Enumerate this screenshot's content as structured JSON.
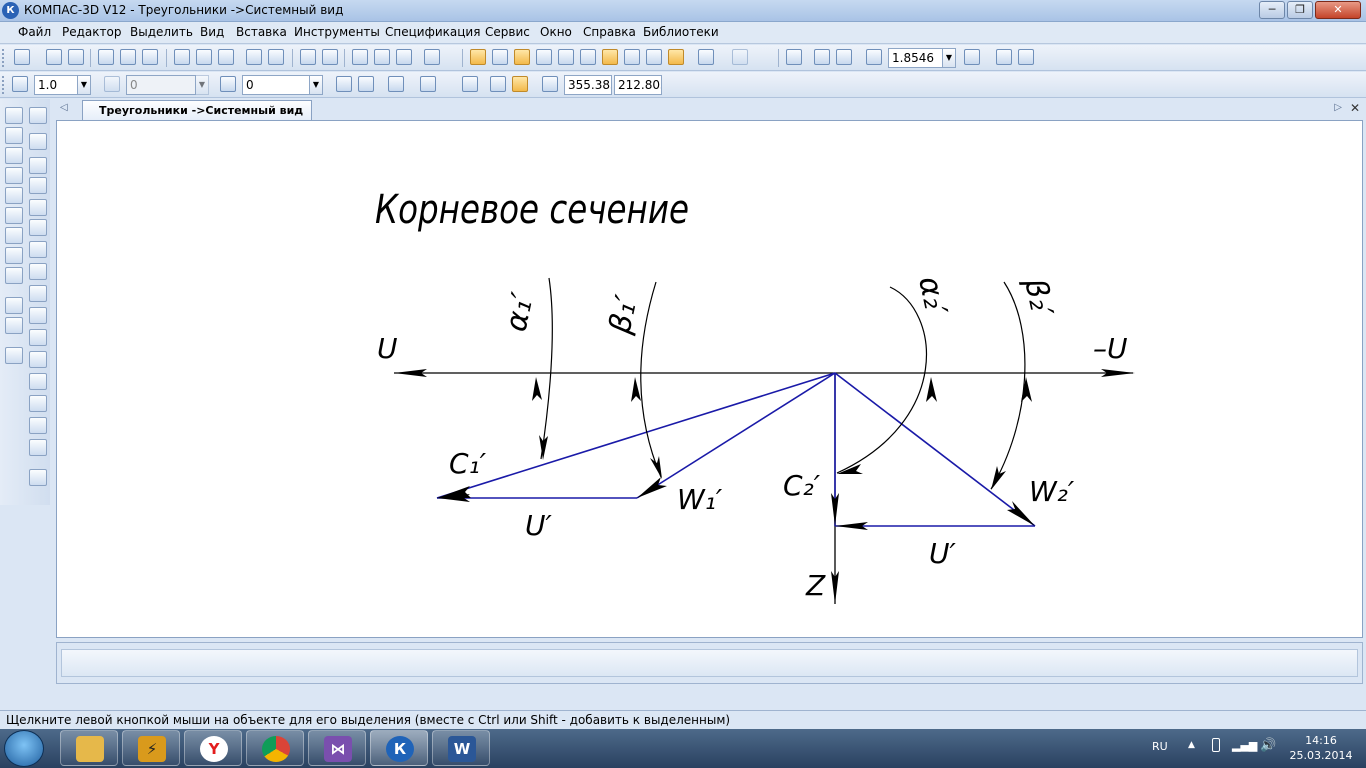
{
  "window": {
    "title": "КОМПАС-3D V12 - Треугольники ->Системный вид",
    "app_icon": "К",
    "controls": [
      "─",
      "❐",
      "✕"
    ]
  },
  "menu": [
    "Файл",
    "Редактор",
    "Выделить",
    "Вид",
    "Вставка",
    "Инструменты",
    "Спецификация",
    "Сервис",
    "Окно",
    "Справка",
    "Библиотеки"
  ],
  "toolbar": {
    "zoom": "1.8546",
    "line_scale": "1.0",
    "layer": "0",
    "state": "0",
    "coord_x": "355.383",
    "coord_y": "212.803"
  },
  "doc_tab": "Треугольники ->Системный вид",
  "drawing": {
    "heading": "Корневое сечение",
    "labels": {
      "u_left": "U",
      "u_right": "–U",
      "alpha1": "α₁′",
      "beta1": "β₁′",
      "alpha2": "α₂′",
      "beta2": "β₂′",
      "c1": "C₁′",
      "w1": "W₁′",
      "u1": "U′",
      "c2": "C₂′",
      "w2": "W₂′",
      "u2": "U′",
      "z": "Z"
    }
  },
  "status": "Щелкните левой кнопкой мыши на объекте для его выделения (вместе с Ctrl или Shift - добавить к выделенным)",
  "taskbar": {
    "apps": [
      "explorer",
      "winamp",
      "yandex",
      "chrome",
      "visual-studio",
      "kompas",
      "word"
    ],
    "lang": "RU",
    "time": "14:16",
    "date": "25.03.2014"
  },
  "colors": {
    "vector_blue": "#1a1aa8",
    "ink": "#000000"
  }
}
